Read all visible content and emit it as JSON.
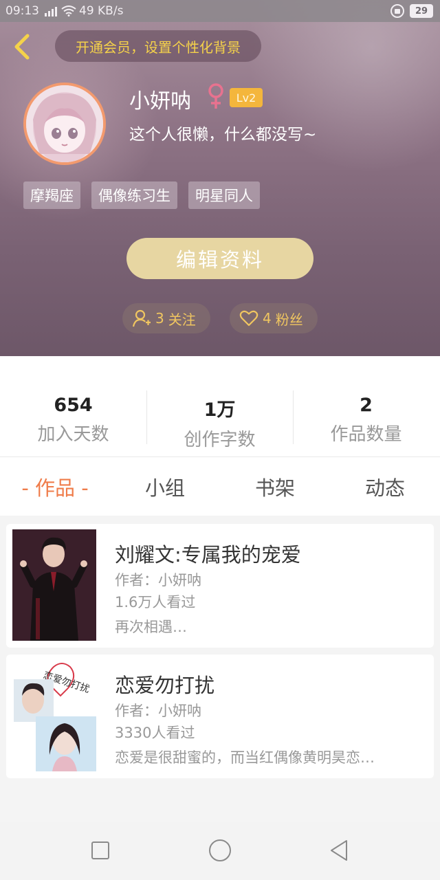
{
  "statusbar": {
    "time": "09:13",
    "network_speed": "49 KB/s",
    "battery": "29"
  },
  "header": {
    "vip_banner": "开通会员，设置个性化背景",
    "username": "小妍呐",
    "level": "Lv2",
    "bio": "这个人很懒，什么都没写~",
    "tags": [
      "摩羯座",
      "偶像练习生",
      "明星同人"
    ],
    "edit_button": "编辑资料",
    "following": {
      "count": "3",
      "label": "关注"
    },
    "fans": {
      "count": "4",
      "label": "粉丝"
    }
  },
  "stats": [
    {
      "value": "654",
      "label": "加入天数"
    },
    {
      "value": "1万",
      "label": "创作字数"
    },
    {
      "value": "2",
      "label": "作品数量"
    }
  ],
  "tabs": [
    {
      "label": "- 作品 -",
      "active": true
    },
    {
      "label": "小组",
      "active": false
    },
    {
      "label": "书架",
      "active": false
    },
    {
      "label": "动态",
      "active": false
    }
  ],
  "works": [
    {
      "title": "刘耀文:专属我的宠爱",
      "author": "作者：小妍呐",
      "views": "1.6万人看过",
      "desc": "再次相遇…"
    },
    {
      "title": "恋爱勿打扰",
      "author": "作者：小妍呐",
      "views": "3330人看过",
      "desc": "恋爱是很甜蜜的，而当红偶像黄明昊恋…",
      "cover_text": "恋爱勿打扰"
    }
  ],
  "colors": {
    "accent": "#ef7c4a",
    "gold": "#f5d24a",
    "edit_button": "#e7d6a2"
  },
  "icons": [
    "back-arrow-icon",
    "female-icon",
    "follow-user-icon",
    "heart-icon",
    "nav-square-icon",
    "nav-circle-icon",
    "nav-back-triangle-icon"
  ]
}
